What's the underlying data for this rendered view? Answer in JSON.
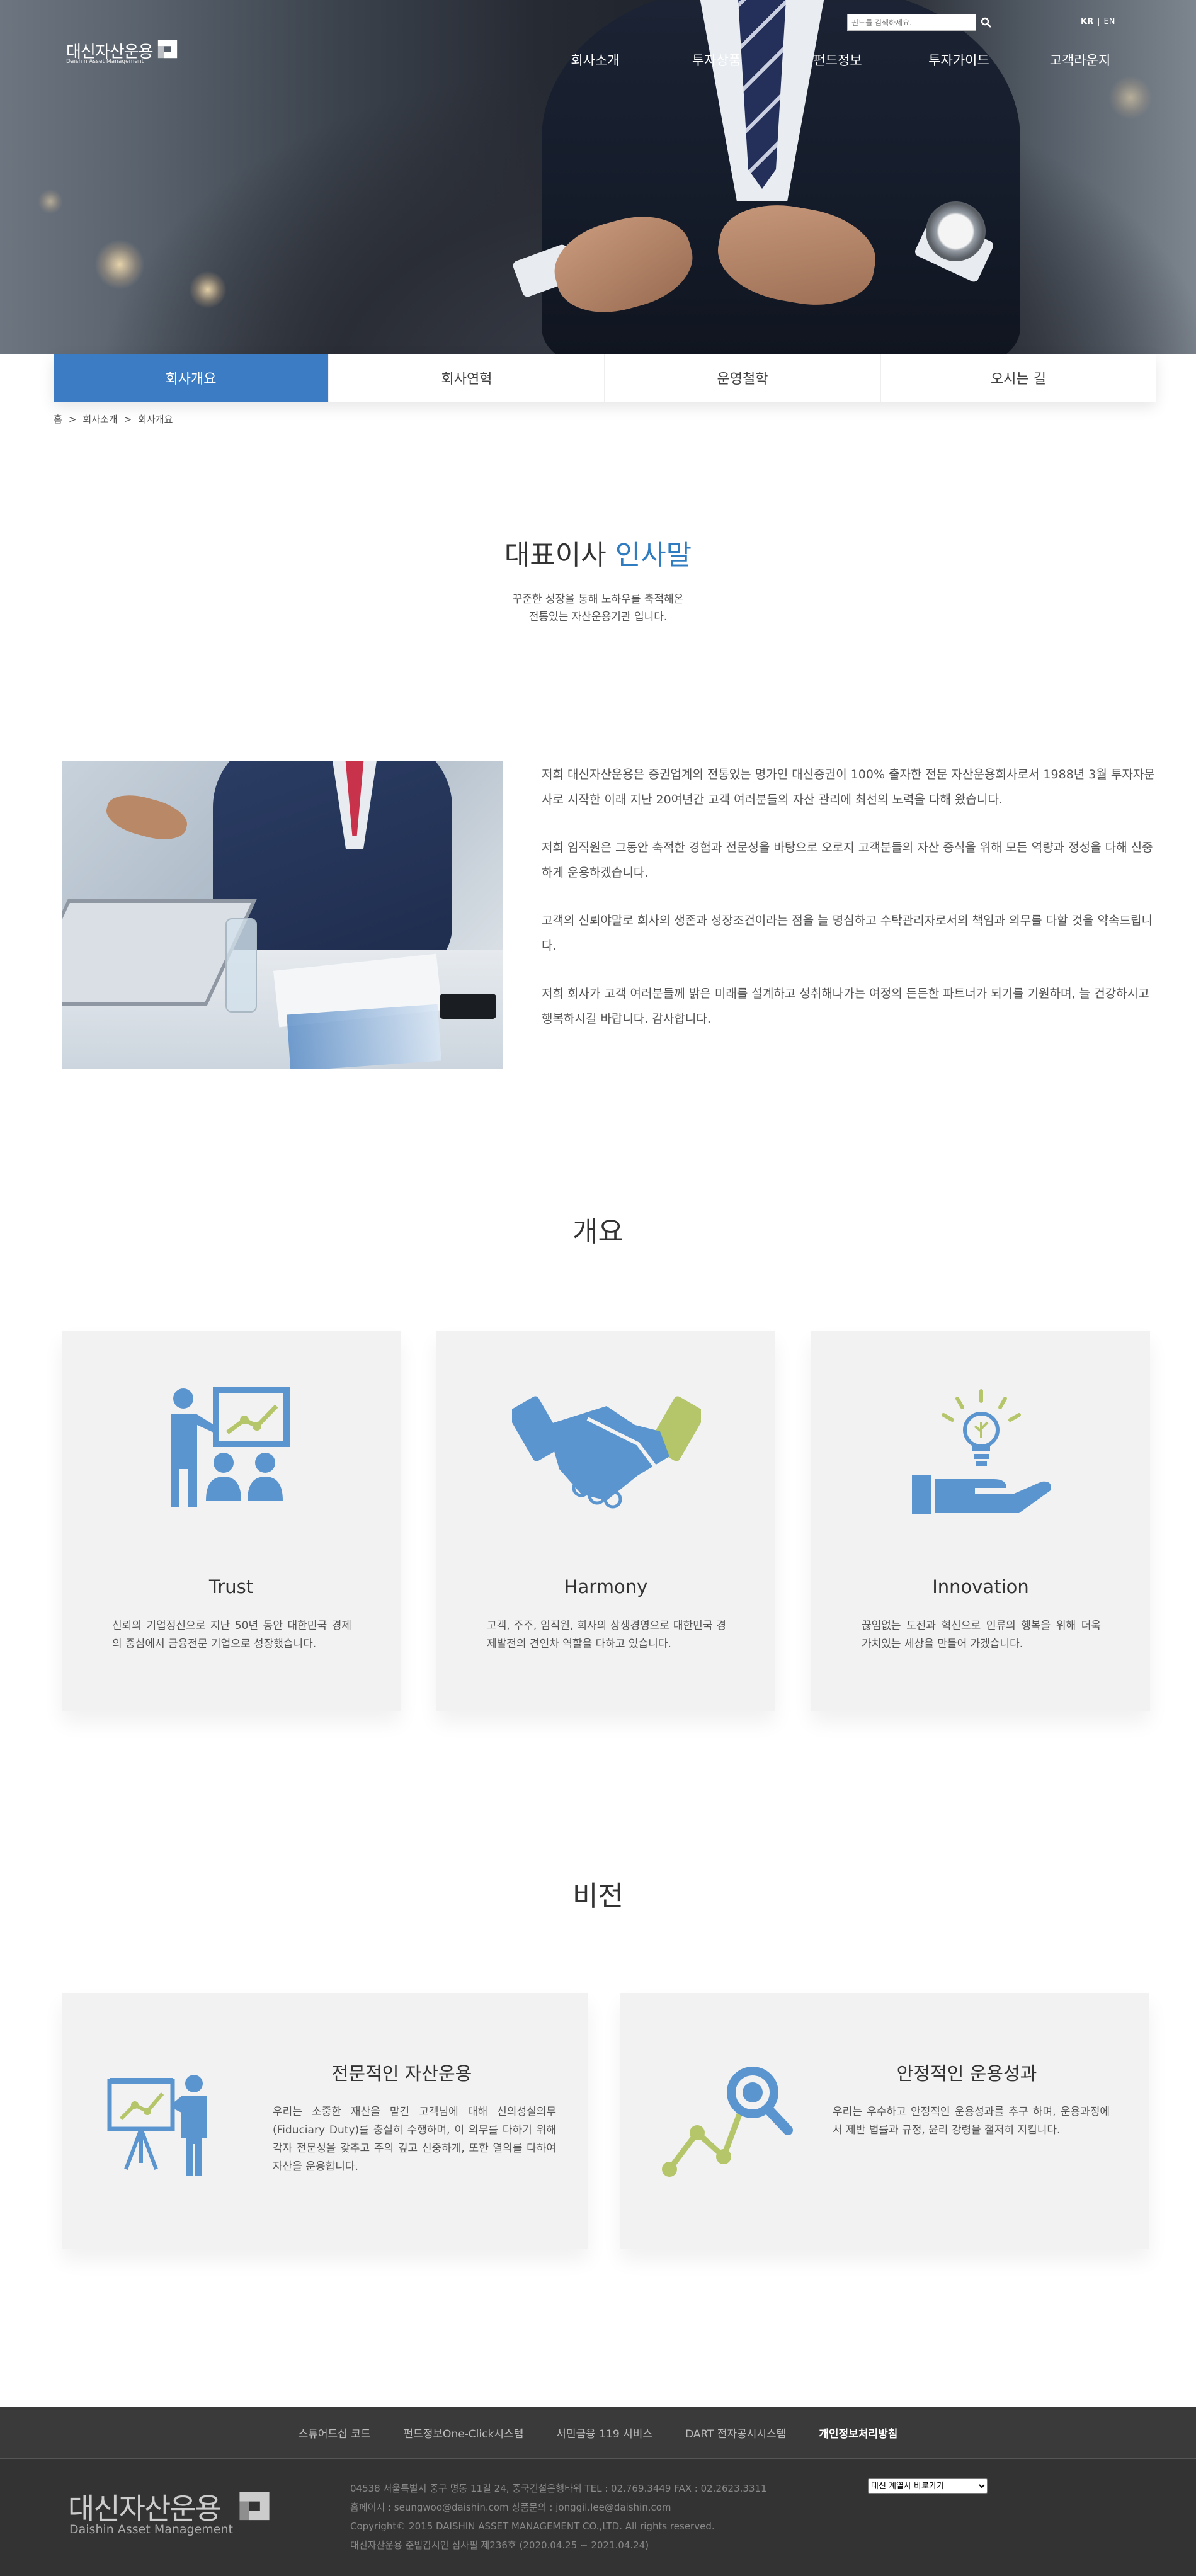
{
  "header": {
    "logo_ko": "대신자산운용",
    "logo_en": "Daishin Asset Management",
    "search_placeholder": "펀드를 검색하세요.",
    "lang_kr": "KR",
    "lang_sep": "|",
    "lang_en": "EN",
    "nav": [
      "회사소개",
      "투자상품",
      "펀드정보",
      "투자가이드",
      "고객라운지"
    ]
  },
  "tabs": [
    {
      "label": "회사개요",
      "active": true
    },
    {
      "label": "회사연혁",
      "active": false
    },
    {
      "label": "운영철학",
      "active": false
    },
    {
      "label": "오시는 길",
      "active": false
    }
  ],
  "breadcrumb": [
    "홈",
    ">",
    "회사소개",
    ">",
    "회사개요"
  ],
  "greeting": {
    "title_main": "대표이사 ",
    "title_highlight": "인사말",
    "subtitle_line1": "꾸준한 성장을 통해 노하우를 축적해온",
    "subtitle_line2": "전통있는 자산운용기관 입니다.",
    "paragraphs": [
      "저희 대신자산운용은 증권업계의 전통있는 명가인 대신증권이 100% 출자한 전문 자산운용회사로서 1988년 3월 투자자문사로 시작한 이래 지난 20여년간 고객 여러분들의 자산 관리에 최선의 노력을 다해 왔습니다.",
      "저희 임직원은 그동안 축적한 경험과 전문성을 바탕으로 오로지 고객분들의 자산 증식을 위해 모든 역량과 정성을 다해 신중하게 운용하겠습니다.",
      "고객의 신뢰야말로 회사의 생존과 성장조건이라는 점을 늘 명심하고 수탁관리자로서의 책임과 의무를 다할 것을 약속드립니다.",
      "저희 회사가 고객 여러분들께 밝은 미래를 설계하고 성취해나가는 여정의 든든한 파트너가 되기를 기원하며, 늘 건강하시고 행복하시길 바랍니다. 감사합니다."
    ]
  },
  "overview": {
    "title": "개요",
    "cards": [
      {
        "icon": "presentation-icon",
        "title": "Trust",
        "desc": "신뢰의 기업정신으로 지난 50년 동안 대한민국 경제의 중심에서 금융전문 기업으로 성장했습니다."
      },
      {
        "icon": "handshake-icon",
        "title": "Harmony",
        "desc": "고객, 주주, 임직원, 회사의 상생경영으로 대한민국 경제발전의 견인차 역할을 다하고 있습니다."
      },
      {
        "icon": "lightbulb-hand-icon",
        "title": "Innovation",
        "desc": "끊임없는 도전과 혁신으로 인류의 행복을 위해 더욱 가치있는 세상을 만들어 가겠습니다."
      }
    ]
  },
  "vision": {
    "title": "비전",
    "cards": [
      {
        "icon": "chart-presenter-icon",
        "title": "전문적인 자산운용",
        "desc": "우리는 소중한 재산을 맡긴 고객님에 대해 신의성실의무(Fiduciary Duty)를 충실히 수행하며, 이 의무를 다하기 위해 각자 전문성을 갖추고 주의 깊고 신중하게, 또한 열의를 다하여 자산을 운용합니다."
      },
      {
        "icon": "analytics-magnifier-icon",
        "title": "안정적인 운용성과",
        "desc": "우리는 우수하고 안정적인 운용성과를 추구 하며, 운용과정에서 제반 법률과 규정, 윤리 강령을 철저히 지킵니다."
      }
    ]
  },
  "footer": {
    "links": [
      "스튜어드십 코드",
      "펀드정보One-Click시스템",
      "서민금융 119 서비스",
      "DART 전자공시시스템",
      "개인정보처리방침"
    ],
    "logo_ko": "대신자산운용",
    "logo_en": "Daishin Asset Management",
    "info": [
      "04538 서울특별시 중구 명동 11길 24, 중국건설은행타워   TEL : 02.769.3449   FAX : 02.2623.3311",
      "홈페이지 : seungwoo@daishin.com   상품문의 : jonggil.lee@daishin.com",
      "Copyright© 2015 DAISHIN ASSET MANAGEMENT CO.,LTD.  All rights reserved.",
      "대신자산운용 준법감시인 심사필 제236호 (2020.04.25 ~ 2021.04.24)"
    ],
    "select_value": "대신 계열사 바로가기"
  },
  "colors": {
    "accent": "#3b7cc4",
    "icon_blue": "#5b95cf",
    "icon_green": "#b5c56a",
    "footer": "#333333"
  }
}
